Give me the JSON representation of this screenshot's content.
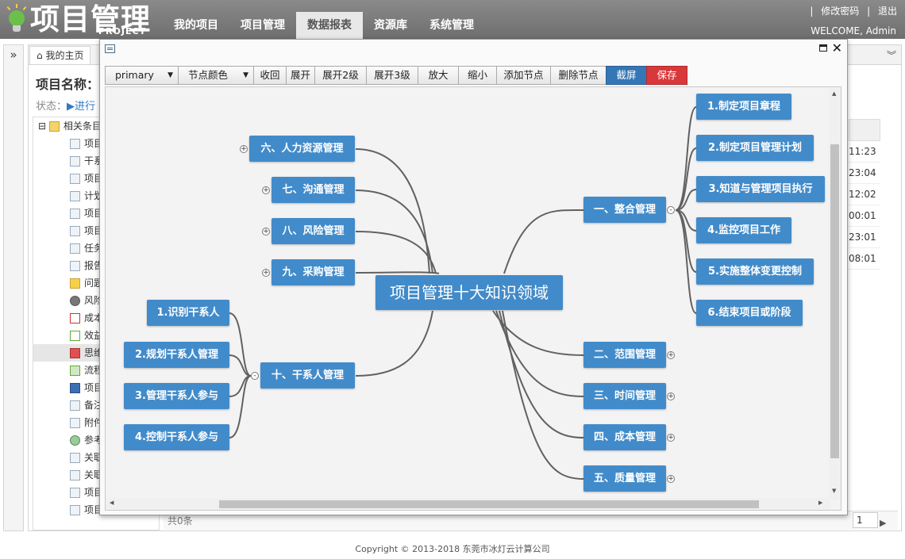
{
  "app": {
    "logo_text": "项目管理",
    "logo_sub": "PROJECT",
    "nav": [
      "我的项目",
      "项目管理",
      "数据报表",
      "资源库",
      "系统管理"
    ],
    "top_links": [
      "|",
      "修改密码",
      "|",
      "退出"
    ],
    "welcome": "WELCOME, Admin",
    "home_tab": "我的主页",
    "project_label": "项目名称：",
    "status_label": "状态：",
    "status_value": "进行",
    "tree_root": "相关条目",
    "tree_items": [
      "项目",
      "干系",
      "项目",
      "计划",
      "项目",
      "项目",
      "任务",
      "报告",
      "问题",
      "风险",
      "成本",
      "效益",
      "思维",
      "流程",
      "项目",
      "备注",
      "附件",
      "参考",
      "关联",
      "关联",
      "项目",
      "项目"
    ],
    "grid_times": [
      "11:23",
      "23:04",
      "12:02",
      "00:01",
      "23:01",
      "08:01"
    ],
    "pager_total": "共0条",
    "pager_page": "1",
    "footer": "Copyright © 2013-2018 东莞市冰灯云计算公司"
  },
  "dialog": {
    "toolbar": {
      "theme_select": "primary",
      "color_select": "节点颜色",
      "collapse": "收回",
      "expand": "展开",
      "expand2": "展开2级",
      "expand3": "展开3级",
      "zoom_in": "放大",
      "zoom_out": "缩小",
      "add_node": "添加节点",
      "delete_node": "删除节点",
      "screenshot": "截屏",
      "save": "保存"
    },
    "mindmap": {
      "root": "项目管理十大知识领域",
      "branch_integration": "一、整合管理",
      "branch_scope": "二、范围管理",
      "branch_time": "三、时间管理",
      "branch_cost": "四、成本管理",
      "branch_quality": "五、质量管理",
      "branch_hr": "六、人力资源管理",
      "branch_comm": "七、沟通管理",
      "branch_risk": "八、风险管理",
      "branch_procure": "九、采购管理",
      "branch_stakeholder": "十、干系人管理",
      "int_1": "1.制定项目章程",
      "int_2": "2.制定项目管理计划",
      "int_3": "3.知道与管理项目执行",
      "int_4": "4.监控项目工作",
      "int_5": "5.实施整体变更控制",
      "int_6": "6.结束项目或阶段",
      "stk_1": "1.识别干系人",
      "stk_2": "2.规划干系人管理",
      "stk_3": "3.管理干系人参与",
      "stk_4": "4.控制干系人参与"
    },
    "colors": {
      "node": "#428bca",
      "screenshot_btn": "#3576b7",
      "save_btn": "#d9383a"
    }
  }
}
